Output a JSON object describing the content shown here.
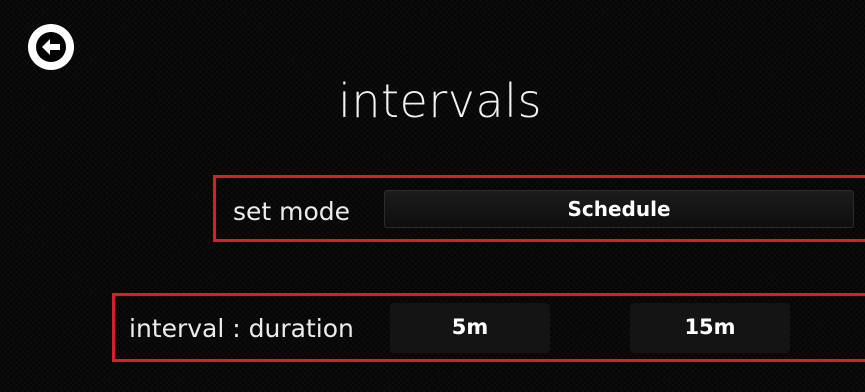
{
  "header": {
    "back_icon": "arrow-left-circle-icon",
    "title": "intervals"
  },
  "set_mode": {
    "label": "set mode",
    "value": "Schedule"
  },
  "interval_duration": {
    "label": "interval : duration",
    "interval_value": "5m",
    "duration_value": "15m"
  },
  "colors": {
    "background": "#000000",
    "highlight_border": "#d4202a",
    "text": "#ffffff"
  }
}
